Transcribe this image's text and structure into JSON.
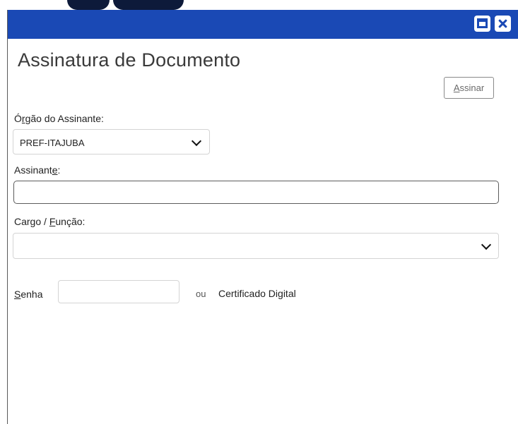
{
  "dialog": {
    "title": "Assinatura de Documento",
    "accent_color": "#1a49b5",
    "window_controls": [
      "maximize-icon",
      "close-icon"
    ]
  },
  "toolbar": {
    "assinar_access_key": "A",
    "assinar_rest": "ssinar"
  },
  "form": {
    "orgao_label_pre": "Ó",
    "orgao_label_key": "r",
    "orgao_label_post": "gão do Assinante:",
    "orgao_selected": "PREF-ITAJUBA",
    "assinante_label_pre": "Assinant",
    "assinante_label_key": "e",
    "assinante_label_post": ":",
    "assinante_value": "",
    "cargo_label_pre": "Cargo / ",
    "cargo_label_key": "F",
    "cargo_label_post": "unção:",
    "cargo_selected": "",
    "senha_label_key": "S",
    "senha_label_post": "enha",
    "senha_value": "",
    "ou_text": "ou",
    "certificado_text": "Certificado Digital"
  }
}
